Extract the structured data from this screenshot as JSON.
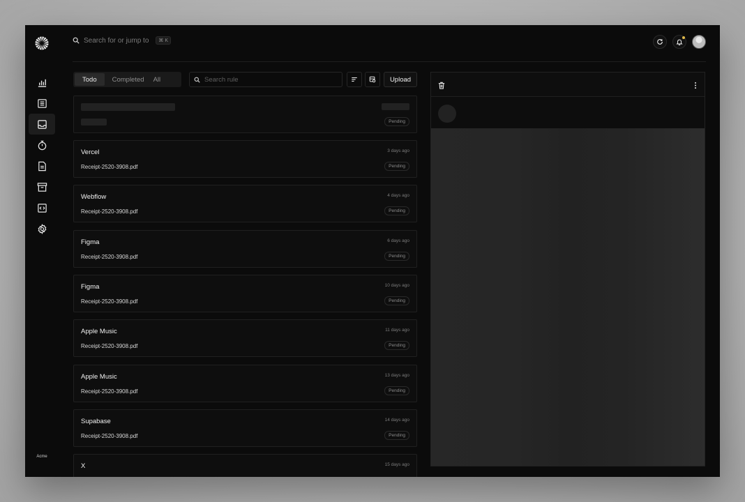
{
  "sidebar": {
    "workspace_label": "Acme",
    "items": [
      {
        "icon": "bar-chart-icon"
      },
      {
        "icon": "list-icon"
      },
      {
        "icon": "inbox-icon",
        "active": true
      },
      {
        "icon": "stopwatch-icon"
      },
      {
        "icon": "document-icon"
      },
      {
        "icon": "archive-icon"
      },
      {
        "icon": "code-file-icon"
      },
      {
        "icon": "gear-icon"
      }
    ]
  },
  "topbar": {
    "search_text": "Search for or jump to",
    "shortcut": "⌘ K"
  },
  "toolbar": {
    "tabs": [
      "Todo",
      "Completed",
      "All"
    ],
    "active_tab": "Todo",
    "rule_search_placeholder": "Search rule",
    "upload_label": "Upload"
  },
  "items": [
    {
      "title": "Vercel",
      "file": "Receipt-2520-3908.pdf",
      "time": "3 days ago",
      "status": "Pending"
    },
    {
      "title": "Webflow",
      "file": "Receipt-2520-3908.pdf",
      "time": "4 days ago",
      "status": "Pending"
    },
    {
      "title": "Figma",
      "file": "Receipt-2520-3908.pdf",
      "time": "6 days ago",
      "status": "Pending"
    },
    {
      "title": "Figma",
      "file": "Receipt-2520-3908.pdf",
      "time": "10 days ago",
      "status": "Pending"
    },
    {
      "title": "Apple Music",
      "file": "Receipt-2520-3908.pdf",
      "time": "11 days ago",
      "status": "Pending"
    },
    {
      "title": "Apple Music",
      "file": "Receipt-2520-3908.pdf",
      "time": "13 days ago",
      "status": "Pending"
    },
    {
      "title": "Supabase",
      "file": "Receipt-2520-3908.pdf",
      "time": "14 days ago",
      "status": "Pending"
    },
    {
      "title": "X",
      "file": "",
      "time": "15 days ago",
      "status": ""
    }
  ],
  "loading_item": {
    "status": "Pending"
  }
}
